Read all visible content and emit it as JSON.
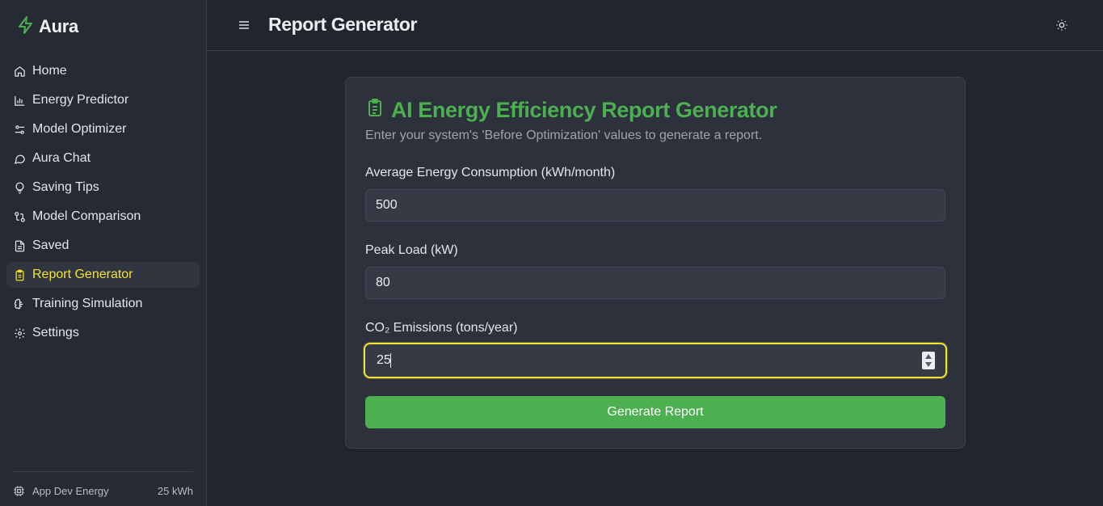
{
  "brand": {
    "name": "Aura",
    "icon": "lightning-icon",
    "accent": "#4caf50"
  },
  "sidebar": {
    "items": [
      {
        "label": "Home",
        "icon": "home-icon"
      },
      {
        "label": "Energy Predictor",
        "icon": "bar-chart-icon"
      },
      {
        "label": "Model Optimizer",
        "icon": "sliders-icon"
      },
      {
        "label": "Aura Chat",
        "icon": "chat-icon"
      },
      {
        "label": "Saving Tips",
        "icon": "lightbulb-icon"
      },
      {
        "label": "Model Comparison",
        "icon": "compare-icon"
      },
      {
        "label": "Saved",
        "icon": "file-icon"
      },
      {
        "label": "Report Generator",
        "icon": "clipboard-icon",
        "active": true
      },
      {
        "label": "Training Simulation",
        "icon": "brain-icon"
      },
      {
        "label": "Settings",
        "icon": "gear-icon"
      }
    ],
    "footer": {
      "label": "App Dev Energy",
      "value": "25 kWh",
      "icon": "cpu-icon"
    }
  },
  "header": {
    "title": "Report Generator",
    "menu_icon": "hamburger-icon",
    "theme_icon": "sun-icon"
  },
  "card": {
    "title": "AI Energy Efficiency Report Generator",
    "subtitle": "Enter your system's 'Before Optimization' values to generate a report.",
    "fields": [
      {
        "label": "Average Energy Consumption (kWh/month)",
        "value": "500"
      },
      {
        "label": "Peak Load (kW)",
        "value": "80"
      },
      {
        "label": "CO₂ Emissions (tons/year)",
        "value": "25"
      }
    ],
    "button_label": "Generate Report"
  },
  "colors": {
    "active_nav": "#f3e233",
    "primary": "#4caf50",
    "background": "#22252d",
    "sidebar": "#262a33"
  }
}
